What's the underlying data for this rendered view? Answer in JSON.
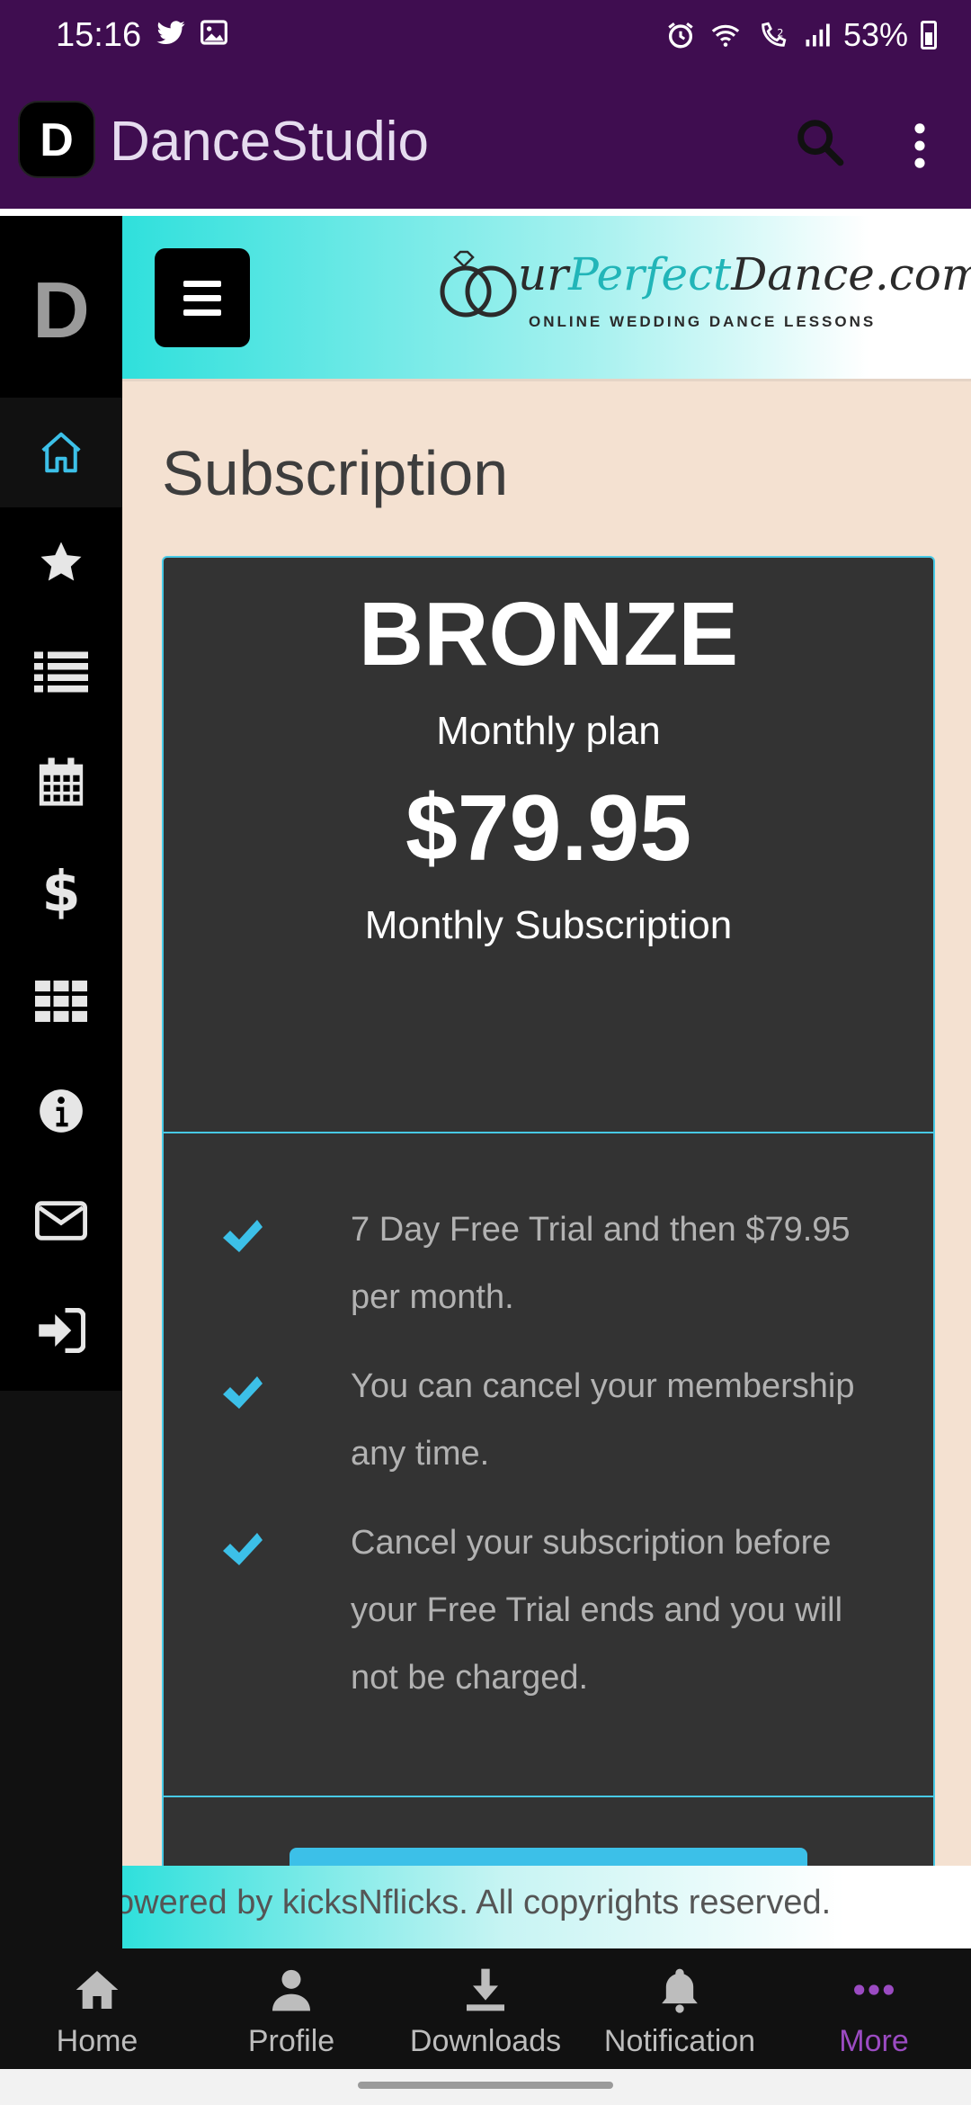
{
  "status": {
    "time": "15:16",
    "battery": "53%",
    "left_icons": [
      "twitter-icon",
      "image-icon"
    ],
    "right_icons": [
      "alarm-icon",
      "wifi-icon",
      "wifi-calling-icon",
      "signal-icon",
      "battery-icon"
    ]
  },
  "app": {
    "logo_letter": "D",
    "title": "DanceStudio"
  },
  "sidebar": {
    "logo_letter": "D",
    "items": [
      {
        "icon": "home-icon",
        "active": true
      },
      {
        "icon": "star-icon"
      },
      {
        "icon": "list-icon"
      },
      {
        "icon": "calendar-icon"
      },
      {
        "icon": "dollar-icon"
      },
      {
        "icon": "grid-icon"
      },
      {
        "icon": "info-icon"
      },
      {
        "icon": "mail-icon"
      },
      {
        "icon": "sign-in-icon"
      }
    ]
  },
  "brand": {
    "name_prefix": "ur",
    "name_accent": "Perfect",
    "name_suffix": "Dance.com",
    "tagline": "ONLINE WEDDING DANCE LESSONS"
  },
  "page": {
    "title": "Subscription"
  },
  "plan": {
    "name": "BRONZE",
    "period": "Monthly plan",
    "price": "$79.95",
    "type": "Monthly Subscription",
    "features": [
      "7 Day Free Trial and then $79.95 per month.",
      "You can cancel your membership any time.",
      "Cancel your subscription before your Free Trial ends and you will not be charged."
    ]
  },
  "footer": {
    "text": "owered by kicksNflicks. All copyrights reserved."
  },
  "bottom_nav": [
    {
      "label": "Home",
      "icon": "home-icon"
    },
    {
      "label": "Profile",
      "icon": "profile-icon"
    },
    {
      "label": "Downloads",
      "icon": "download-icon"
    },
    {
      "label": "Notification",
      "icon": "bell-icon"
    },
    {
      "label": "More",
      "icon": "more-icon",
      "active": true
    }
  ],
  "colors": {
    "app_bar": "#3f0d50",
    "accent_cyan": "#2fe0dc",
    "check_blue": "#3cc0e8",
    "card_bg": "#333333",
    "page_bg": "#f4e1d1",
    "nav_active": "#9b4bc2"
  }
}
